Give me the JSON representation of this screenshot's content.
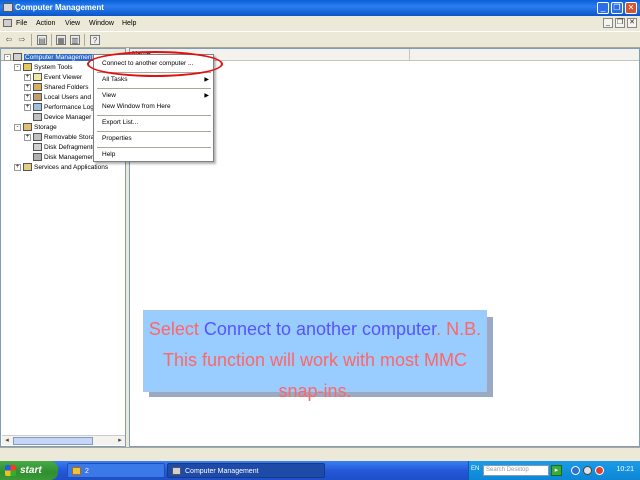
{
  "window": {
    "title": "Computer Management",
    "buttons": {
      "minimize": "_",
      "restore": "❐",
      "close": "✕"
    }
  },
  "menubar": {
    "items": [
      "File",
      "Action",
      "View",
      "Window",
      "Help"
    ]
  },
  "left_pane": {
    "header": "Computer Management (Local)",
    "tree": [
      {
        "label": "Computer Management (Local)",
        "indent": 0,
        "expander": "-",
        "selected": true
      },
      {
        "label": "System Tools",
        "indent": 1,
        "expander": "-"
      },
      {
        "label": "Event Viewer",
        "indent": 2,
        "expander": "+"
      },
      {
        "label": "Shared Folders",
        "indent": 2,
        "expander": "+"
      },
      {
        "label": "Local Users and Groups",
        "indent": 2,
        "expander": "+"
      },
      {
        "label": "Performance Logs and Alerts",
        "indent": 2,
        "expander": "+"
      },
      {
        "label": "Device Manager",
        "indent": 2,
        "expander": ""
      },
      {
        "label": "Storage",
        "indent": 1,
        "expander": "-"
      },
      {
        "label": "Removable Storage",
        "indent": 2,
        "expander": "+"
      },
      {
        "label": "Disk Defragmenter",
        "indent": 2,
        "expander": ""
      },
      {
        "label": "Disk Management",
        "indent": 2,
        "expander": ""
      },
      {
        "label": "Services and Applications",
        "indent": 1,
        "expander": "+"
      }
    ]
  },
  "right_pane": {
    "column_header": "Name"
  },
  "context_menu": {
    "items": {
      "connect": "Connect to another computer ...",
      "all_tasks": "All Tasks",
      "view": "View",
      "new_window": "New Window from Here",
      "export_list": "Export List...",
      "properties": "Properties",
      "help": "Help"
    }
  },
  "callout": {
    "part1": "Select ",
    "part2": "Connect to another computer",
    "part3": ". N.B. This function will work with most MMC snap-ins.",
    "colors": {
      "red": "#ff6666",
      "blue": "#5555ff",
      "background": "#99ccff"
    }
  },
  "taskbar": {
    "start_label": "start",
    "tasks": [
      {
        "label": "2",
        "icon": "folder-icon"
      },
      {
        "label": "Computer Management",
        "icon": "computer-management-icon"
      }
    ],
    "tray": {
      "language": "EN",
      "search_placeholder": "Search Desktop",
      "clock": "10:21"
    }
  }
}
